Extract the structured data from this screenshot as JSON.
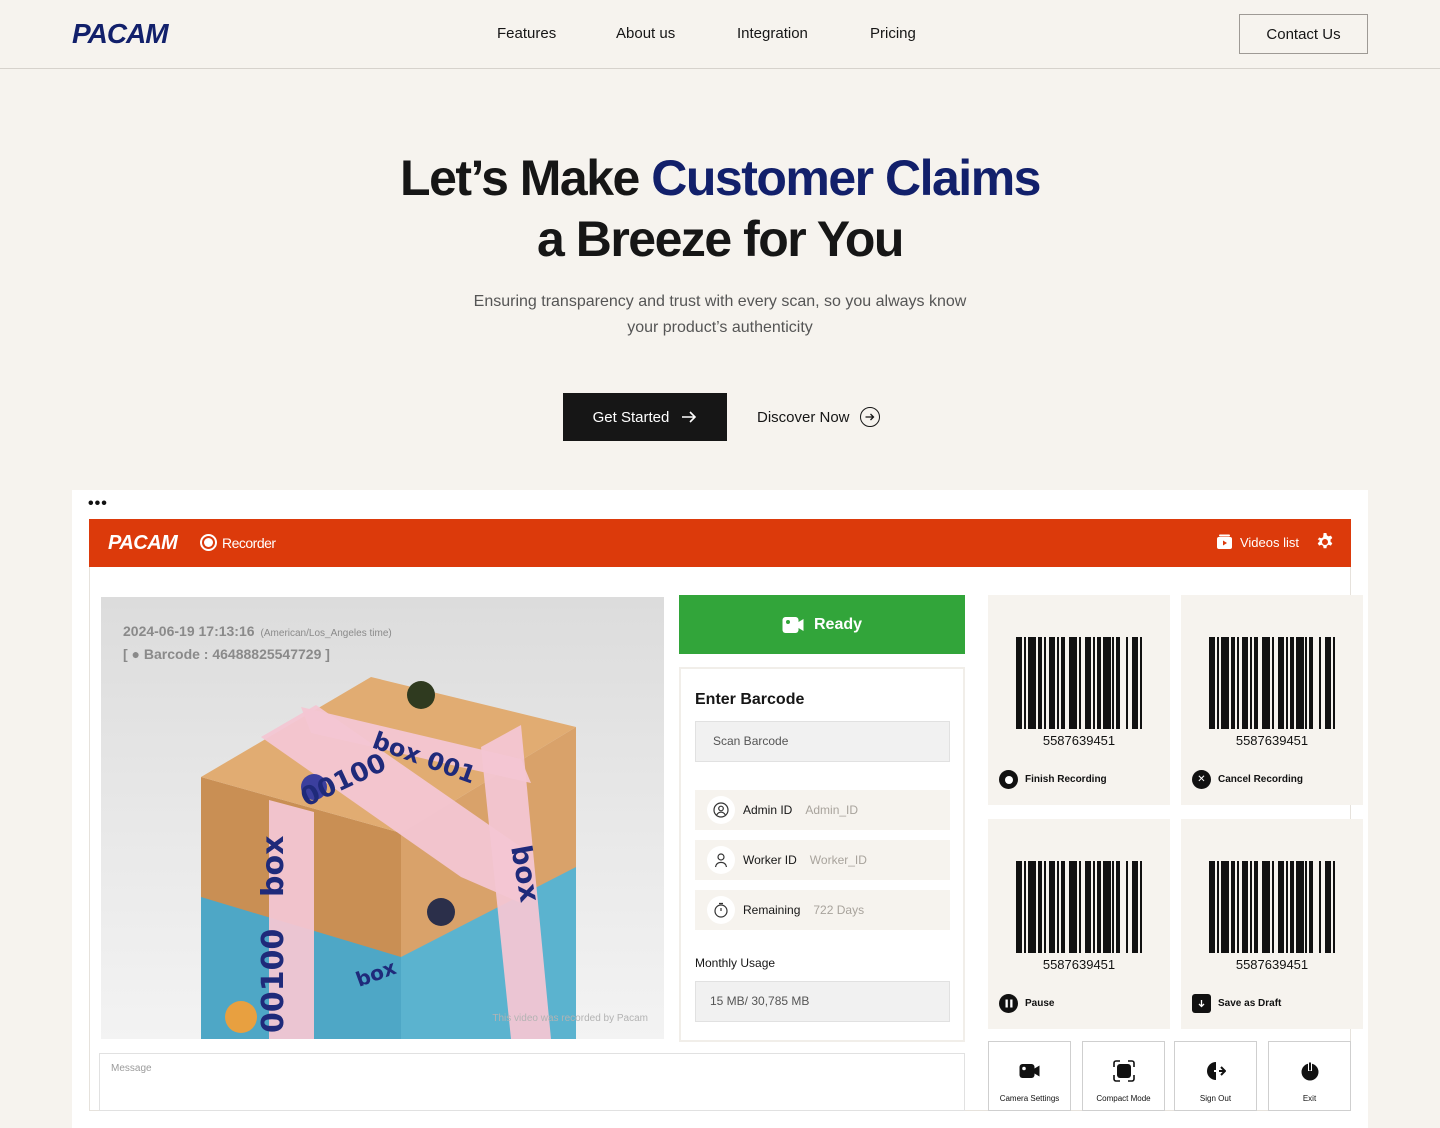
{
  "nav": {
    "logo": "PACAM",
    "links": [
      "Features",
      "About us",
      "Integration",
      "Pricing"
    ],
    "contact": "Contact Us"
  },
  "hero": {
    "title_part1": "Let’s Make ",
    "title_accent": "Customer Claims",
    "title_line2": "a Breeze for You",
    "subtitle": "Ensuring transparency and trust with every scan, so you always know your product’s authenticity",
    "cta_primary": "Get Started",
    "cta_secondary": "Discover Now"
  },
  "app": {
    "logo": "PACAM",
    "recorder_label": "Recorder",
    "videos_list": "Videos list",
    "camera": {
      "timestamp": "2024-06-19  17:13:16",
      "timezone": "(American/Los_Angeles time)",
      "barcode_line": "[ ● Barcode : 46488825547729 ]",
      "watermark": "This video was recorded by Pacam"
    },
    "status": "Ready",
    "enter_barcode": "Enter Barcode",
    "scan_placeholder": "Scan Barcode",
    "admin_label": "Admin ID",
    "admin_value": "Admin_ID",
    "worker_label": "Worker ID",
    "worker_value": "Worker_ID",
    "remaining_label": "Remaining",
    "remaining_value": "722 Days",
    "usage_label": "Monthly Usage",
    "usage_value": "15 MB/ 30,785 MB",
    "message_placeholder": "Message",
    "cards": [
      {
        "number": "5587639451",
        "action": "Finish Recording",
        "icon": "record-stop-icon"
      },
      {
        "number": "5587639451",
        "action": "Cancel Recording",
        "icon": "close-icon"
      },
      {
        "number": "5587639451",
        "action": "Pause",
        "icon": "pause-icon"
      },
      {
        "number": "5587639451",
        "action": "Save as Draft",
        "icon": "save-draft-icon"
      }
    ],
    "tools": [
      {
        "label": "Camera Settings",
        "icon": "camera-icon"
      },
      {
        "label": "Compact Mode",
        "icon": "compact-icon"
      },
      {
        "label": "Sign Out",
        "icon": "sign-out-icon"
      },
      {
        "label": "Exit",
        "icon": "power-icon"
      }
    ]
  },
  "colors": {
    "brand_navy": "#12206b",
    "app_bar": "#dc3a0b",
    "ready_green": "#32a53a",
    "page_bg": "#f6f3ee"
  }
}
